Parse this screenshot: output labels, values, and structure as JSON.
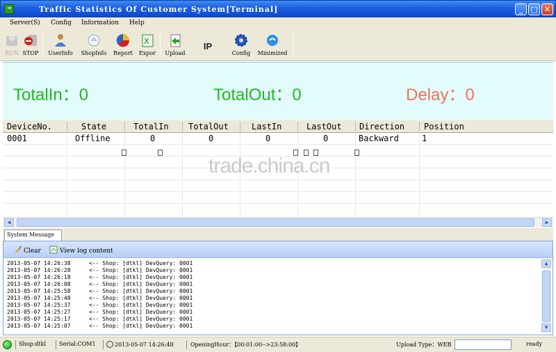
{
  "window": {
    "title": "Traffic Statistics Of Customer System[Terminal]",
    "min_label": "_",
    "max_label": "□",
    "close_label": "✕"
  },
  "menu": [
    "Server(S)",
    "Config",
    "Information",
    "Help"
  ],
  "toolbar": [
    {
      "label": "RUN",
      "icon": "run-icon",
      "enabled": false
    },
    {
      "label": "STOP",
      "icon": "stop-icon",
      "enabled": true
    },
    {
      "label": "UserInfo",
      "icon": "user-icon",
      "enabled": true
    },
    {
      "label": "ShopInfo",
      "icon": "shop-icon",
      "enabled": true
    },
    {
      "label": "Report",
      "icon": "report-icon",
      "enabled": true
    },
    {
      "label": "Expor",
      "icon": "excel-icon",
      "enabled": true
    },
    {
      "label": "Upload",
      "icon": "upload-icon",
      "enabled": true
    },
    {
      "label": "IP",
      "icon": "ip-text",
      "enabled": true
    },
    {
      "label": "Config",
      "icon": "gear-icon",
      "enabled": true
    },
    {
      "label": "Minimized",
      "icon": "minimize-globe-icon",
      "enabled": true
    }
  ],
  "totals": {
    "total_in": "TotalIn：0",
    "total_out": "TotalOut：0",
    "delay": "Delay：0"
  },
  "colors": {
    "green": "#22b822",
    "delay": "#f2735b",
    "panel_bg": "#e2fbfb"
  },
  "grid": {
    "columns": [
      "DeviceNo.",
      "State",
      "TotalIn",
      "TotalOut",
      "LastIn",
      "LastOut",
      "Direction",
      "Position"
    ],
    "rows": [
      [
        "0001",
        "Offline",
        "0",
        "0",
        "0",
        "0",
        "Backward",
        "1"
      ]
    ]
  },
  "watermark": "trade.china.cn",
  "system_message": {
    "tab": "System Message",
    "clear_label": "Clear",
    "view_log_label": "View log content",
    "log": [
      {
        "time": "2013-05-07 14:26:38",
        "msg": "<-- Shop: [dtkl] DevQuery: 0001"
      },
      {
        "time": "2013-05-07 14:26:28",
        "msg": "<-- Shop: [dtkl] DevQuery: 0001"
      },
      {
        "time": "2013-05-07 14:26:18",
        "msg": "<-- Shop: [dtkl] DevQuery: 0001"
      },
      {
        "time": "2013-05-07 14:26:08",
        "msg": "<-- Shop: [dtkl] DevQuery: 0001"
      },
      {
        "time": "2013-05-07 14:25:58",
        "msg": "<-- Shop: [dtkl] DevQuery: 0001"
      },
      {
        "time": "2013-05-07 14:25:48",
        "msg": "<-- Shop: [dtkl] DevQuery: 0001"
      },
      {
        "time": "2013-05-07 14:25:37",
        "msg": "<-- Shop: [dtkl] DevQuery: 0001"
      },
      {
        "time": "2013-05-07 14:25:27",
        "msg": "<-- Shop: [dtkl] DevQuery: 0001"
      },
      {
        "time": "2013-05-07 14:25:17",
        "msg": "<-- Shop: [dtkl] DevQuery: 0001"
      },
      {
        "time": "2013-05-07 14:25:07",
        "msg": "<-- Shop: [dtkl] DevQuery: 0001"
      }
    ]
  },
  "status": {
    "shop": "Shop:dtkl",
    "serial": "Serial:COM1",
    "datetime": "2013-05-07 14:26:48",
    "opening_hour": "OpeningHour：【00:01:00-->23:58:00】",
    "upload_type": "Upload Type：WEB",
    "ready": "ready"
  }
}
